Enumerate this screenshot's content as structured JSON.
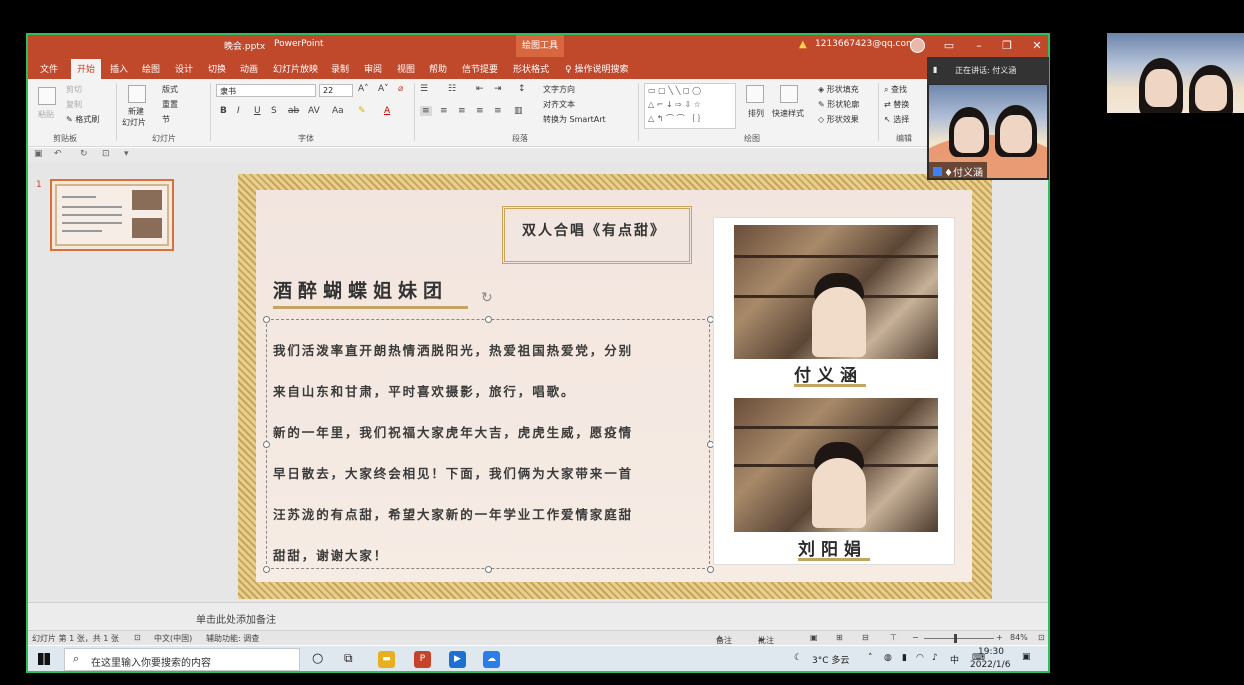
{
  "window": {
    "file_name": "晚会.pptx",
    "app_name": "PowerPoint",
    "tool_context": "绘图工具",
    "account": "1213667423@qq.com"
  },
  "tabs": [
    "文件",
    "开始",
    "插入",
    "绘图",
    "设计",
    "切换",
    "动画",
    "幻灯片放映",
    "录制",
    "审阅",
    "视图",
    "帮助",
    "信节提要",
    "形状格式"
  ],
  "active_tab": "开始",
  "tell_me": "操作说明搜索",
  "ribbon": {
    "clipboard": {
      "paste": "粘贴",
      "cut": "剪切",
      "copy": "复制",
      "format_painter": "格式刷",
      "label": "剪贴板"
    },
    "slides": {
      "new_slide_1": "新建",
      "new_slide_2": "幻灯片",
      "layout": "版式",
      "reset": "重置",
      "section": "节",
      "label": "幻灯片"
    },
    "font": {
      "font_name": "隶书",
      "font_size": "22",
      "label": "字体"
    },
    "paragraph": {
      "text_direction": "文字方向",
      "align_text": "对齐文本",
      "smartart": "转换为 SmartArt",
      "label": "段落"
    },
    "drawing": {
      "arrange": "排列",
      "quick_styles": "快速样式",
      "fill": "形状填充",
      "outline": "形状轮廓",
      "effects": "形状效果",
      "label": "绘图"
    },
    "editing": {
      "find": "查找",
      "replace": "替换",
      "select": "选择",
      "label": "编辑"
    }
  },
  "thumbnail": {
    "number": "1"
  },
  "slide": {
    "song_title": "双人合唱《有点甜》",
    "group_name": "酒醉蝴蝶姐妹团",
    "paragraph_lines": [
      "我们活泼率直开朗热情洒脱阳光，热爱祖国热爱党，分别",
      "来自山东和甘肃，平时喜欢摄影，旅行，唱歌。",
      "新的一年里，我们祝福大家虎年大吉，虎虎生威，愿疫情",
      "早日散去，大家终会相见！下面，我们俩为大家带来一首",
      "汪苏泷的有点甜，希望大家新的一年学业工作爱情家庭甜",
      "甜甜，谢谢大家！"
    ],
    "person1": "付义涵",
    "person2": "刘阳娟"
  },
  "notes_placeholder": "单击此处添加备注",
  "status": {
    "slide_info": "幻灯片 第 1 张，共 1 张",
    "language": "中文(中国)",
    "accessibility": "辅助功能: 调查",
    "notes": "备注",
    "comments": "批注",
    "zoom": "84%"
  },
  "taskbar": {
    "search_placeholder": "在这里输入你要搜索的内容",
    "weather": "3°C 多云",
    "ime": "中",
    "time": "19:30",
    "date": "2022/1/6"
  },
  "meeting": {
    "speaking_label": "正在讲话: 付义涵",
    "speaker_name": "付义涵"
  },
  "colors": {
    "ppt_accent": "#c0482b",
    "share_border": "#2fbf5a",
    "slide_gold": "#c4a461"
  }
}
